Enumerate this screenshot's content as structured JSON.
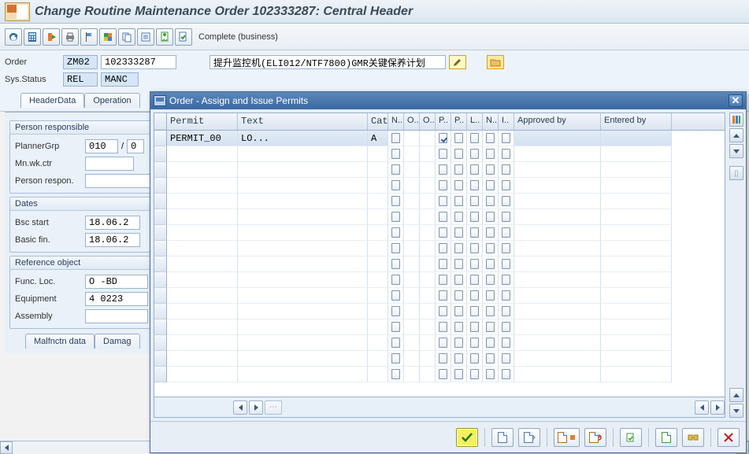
{
  "title": "Change Routine Maintenance Order 102333287: Central Header",
  "toolbar": {
    "complete_label": "Complete (business)"
  },
  "header": {
    "order_label": "Order",
    "order_type": "ZM02",
    "order_no": "102333287",
    "order_text": "提升监控机(ELI012/NTF7800)GMR关键保养计划",
    "sysstatus_label": "Sys.Status",
    "sysstatus_rel": "REL",
    "sysstatus_rest": "MANC"
  },
  "tabs": {
    "header": "HeaderData",
    "operations": "Operation"
  },
  "group_person": {
    "title": "Person responsible",
    "plannergrp_label": "PlannerGrp",
    "plannergrp_val": "010",
    "plannergrp_sep": "/",
    "plannergrp_rest": "0",
    "mnwkctr_label": "Mn.wk.ctr",
    "personresp_label": "Person respon."
  },
  "group_dates": {
    "title": "Dates",
    "bscstart_label": "Bsc start",
    "bscstart_val": "18.06.2",
    "basicfin_label": "Basic fin.",
    "basicfin_val": "18.06.2"
  },
  "group_ref": {
    "title": "Reference object",
    "funcloc_label": "Func. Loc.",
    "funcloc_val": "O   -BD",
    "equip_label": "Equipment",
    "equip_val": "4   0223",
    "assembly_label": "Assembly"
  },
  "bottom_tabs": {
    "malf": "Malfnctn data",
    "dam": "Damag"
  },
  "dialog": {
    "title": "Order - Assign and Issue Permits",
    "columns": {
      "permit": "Permit",
      "text": "Text",
      "cat": "Cat",
      "n1": "N..",
      "o1": "O..",
      "o2": "O..",
      "p1": "P..",
      "p2": "P..",
      "l": "L..",
      "n2": "N..",
      "i": "I..",
      "approved": "Approved by",
      "entered": "Entered by"
    },
    "rows": [
      {
        "permit": "PERMIT_00",
        "text": "LO...",
        "cat": "A",
        "chk": [
          false,
          null,
          null,
          true,
          false,
          false,
          false,
          false
        ],
        "approved": "",
        "entered": ""
      }
    ],
    "empty_rows": 15
  }
}
